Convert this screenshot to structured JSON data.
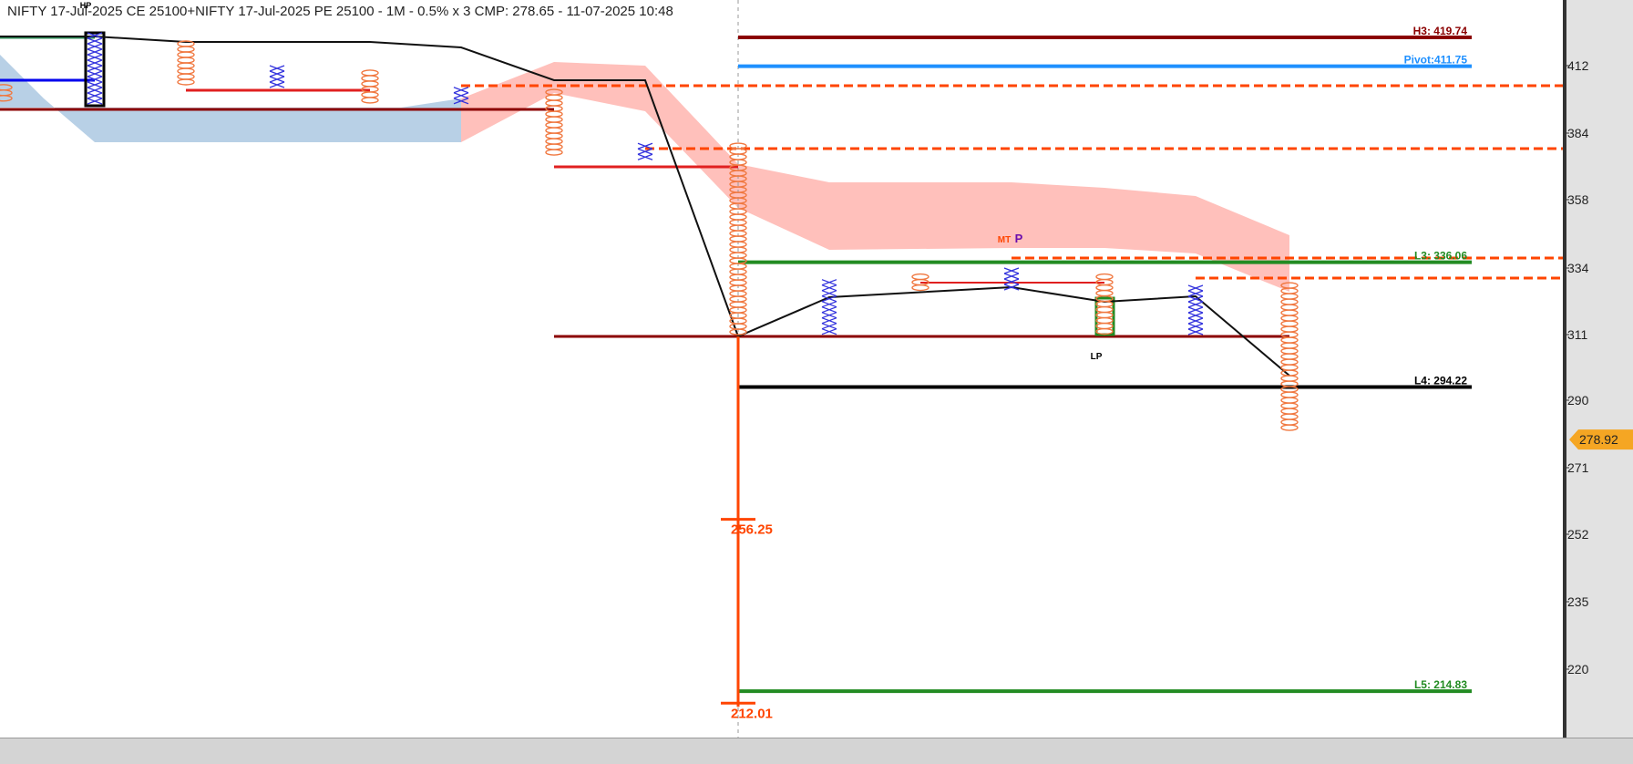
{
  "title": "NIFTY 17-Jul-2025 CE 25100+NIFTY 17-Jul-2025 PE 25100 - 1M - 0.5% x 3 CMP: 278.65 - 11-07-2025 10:48",
  "colors": {
    "background": "#ffffff",
    "box_x": "#3333dd",
    "box_o": "#f07840",
    "price_tag": "#f5a623",
    "h3": "#8b0000",
    "pivot": "#1e90ff",
    "l3": "#228b22",
    "l4": "#000000",
    "l5": "#228b22",
    "dashed": "#ff4500",
    "cloud_red": "#ffc0bb",
    "cloud_blue": "#b8d0e6",
    "trend": "#111111",
    "column_line": "#ff4500"
  },
  "chart_data": {
    "type": "point-and-figure",
    "y_ticks": [
      412,
      384,
      358,
      334,
      311,
      290,
      271,
      252,
      235,
      220
    ],
    "ylim": [
      208,
      420
    ],
    "current_price": {
      "label": "278.92",
      "value": 278.92
    },
    "levels": [
      {
        "name": "H3",
        "label": "H3: 419.74",
        "value": 419.74,
        "color": "#8b0000"
      },
      {
        "name": "Pivot",
        "label": "Pivot:411.75",
        "value": 411.75,
        "color": "#1e90ff"
      },
      {
        "name": "L3",
        "label": "L3: 336.06",
        "value": 336.06,
        "color": "#228b22"
      },
      {
        "name": "L4",
        "label": "L4: 294.22",
        "value": 294.22,
        "color": "#000000"
      },
      {
        "name": "L5",
        "label": "L5: 214.83",
        "value": 214.83,
        "color": "#228b22"
      }
    ],
    "column_annotations": [
      {
        "label": "256.25",
        "value": 256.25
      },
      {
        "label": "212.01",
        "value": 212.01
      }
    ],
    "text_markers": [
      {
        "label": "MT",
        "value": 344
      },
      {
        "label": "P",
        "value": 344
      },
      {
        "label": "LP",
        "value": 304
      },
      {
        "label": "HP",
        "value": 421
      }
    ],
    "columns": [
      {
        "type": "O",
        "high": 403,
        "low": 397
      },
      {
        "type": "X",
        "high": 421,
        "low": 398
      },
      {
        "type": "O",
        "high": 418,
        "low": 403
      },
      {
        "type": "X",
        "high": 412,
        "low": 404
      },
      {
        "type": "O",
        "high": 409,
        "low": 397
      },
      {
        "type": "X",
        "high": 403,
        "low": 397
      },
      {
        "type": "O",
        "high": 401,
        "low": 376
      },
      {
        "type": "X",
        "high": 380,
        "low": 375
      },
      {
        "type": "O",
        "high": 379,
        "low": 311
      },
      {
        "type": "X",
        "high": 330,
        "low": 312
      },
      {
        "type": "O",
        "high": 331,
        "low": 327
      },
      {
        "type": "X",
        "high": 334,
        "low": 328
      },
      {
        "type": "O",
        "high": 331,
        "low": 312
      },
      {
        "type": "X",
        "high": 328,
        "low": 312
      },
      {
        "type": "O",
        "high": 328,
        "low": 281
      }
    ]
  }
}
